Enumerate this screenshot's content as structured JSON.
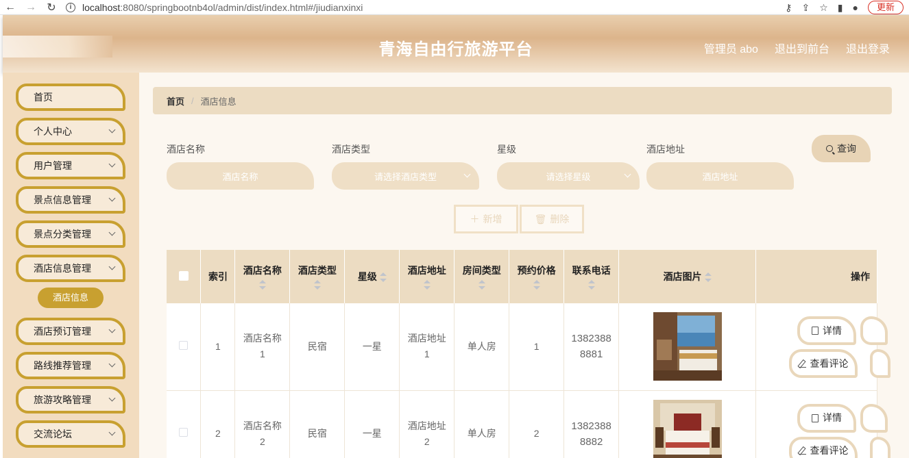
{
  "browser": {
    "url_host": "localhost",
    "url_path": ":8080/springbootnb4ol/admin/dist/index.html#/jiudianxinxi",
    "update_label": "更新"
  },
  "header": {
    "title": "青海自由行旅游平台",
    "admin_label": "管理员 abo",
    "back_front_label": "退出到前台",
    "logout_label": "退出登录"
  },
  "sidebar": {
    "items": [
      {
        "label": "首页",
        "expandable": false
      },
      {
        "label": "个人中心",
        "expandable": true
      },
      {
        "label": "用户管理",
        "expandable": true
      },
      {
        "label": "景点信息管理",
        "expandable": true
      },
      {
        "label": "景点分类管理",
        "expandable": true
      },
      {
        "label": "酒店信息管理",
        "expandable": true
      },
      {
        "label": "酒店预订管理",
        "expandable": true
      },
      {
        "label": "路线推荐管理",
        "expandable": true
      },
      {
        "label": "旅游攻略管理",
        "expandable": true
      },
      {
        "label": "交流论坛",
        "expandable": true
      }
    ],
    "active_sub": "酒店信息"
  },
  "breadcrumb": {
    "home": "首页",
    "separator": "/",
    "current": "酒店信息"
  },
  "search": {
    "name_label": "酒店名称",
    "name_placeholder": "酒店名称",
    "type_label": "酒店类型",
    "type_placeholder": "请选择酒店类型",
    "star_label": "星级",
    "star_placeholder": "请选择星级",
    "addr_label": "酒店地址",
    "addr_placeholder": "酒店地址",
    "query_label": "查询"
  },
  "actions": {
    "add_label": "新增",
    "delete_label": "删除"
  },
  "table": {
    "headers": [
      "索引",
      "酒店名称",
      "酒店类型",
      "星级",
      "酒店地址",
      "房间类型",
      "预约价格",
      "联系电话",
      "酒店图片",
      "操作"
    ],
    "rows": [
      {
        "index": "1",
        "name": "酒店名称1",
        "type": "民宿",
        "star": "一星",
        "address": "酒店地址1",
        "room": "单人房",
        "price": "1",
        "phone": "13823888881",
        "image": "hotel-room-seaview"
      },
      {
        "index": "2",
        "name": "酒店名称2",
        "type": "民宿",
        "star": "一星",
        "address": "酒店地址2",
        "room": "单人房",
        "price": "2",
        "phone": "13823888882",
        "image": "hotel-room-bedroom"
      }
    ],
    "detail_label": "详情",
    "comment_label": "查看评论"
  },
  "colors": {
    "accent": "#c8a030",
    "sidebar_bg": "#f2dcbf",
    "header_bg": "#ecdcc2"
  }
}
